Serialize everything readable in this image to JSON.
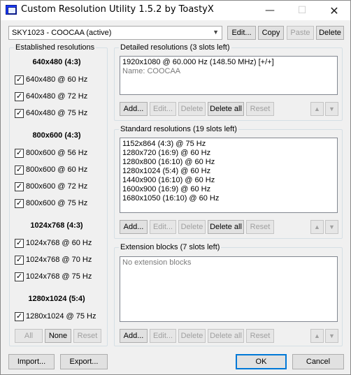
{
  "window": {
    "title": "Custom Resolution Utility 1.5.2 by ToastyX",
    "minimize_glyph": "—",
    "maximize_glyph": "☐",
    "close_glyph": "✕"
  },
  "toolbar": {
    "monitor_select": "SKY1023 - COOCAA (active)",
    "edit_label": "Edit...",
    "copy_label": "Copy",
    "paste_label": "Paste",
    "delete_label": "Delete"
  },
  "established": {
    "title": "Established resolutions",
    "check_glyph": "✓",
    "groups": [
      {
        "header": "640x480 (4:3)",
        "items": [
          "640x480 @ 60 Hz",
          "640x480 @ 72 Hz",
          "640x480 @ 75 Hz"
        ]
      },
      {
        "header": "800x600 (4:3)",
        "items": [
          "800x600 @ 56 Hz",
          "800x600 @ 60 Hz",
          "800x600 @ 72 Hz",
          "800x600 @ 75 Hz"
        ]
      },
      {
        "header": "1024x768 (4:3)",
        "items": [
          "1024x768 @ 60 Hz",
          "1024x768 @ 70 Hz",
          "1024x768 @ 75 Hz"
        ]
      },
      {
        "header": "1280x1024 (5:4)",
        "items": [
          "1280x1024 @ 75 Hz"
        ]
      }
    ],
    "all_label": "All",
    "none_label": "None",
    "reset_label": "Reset"
  },
  "detailed": {
    "title": "Detailed resolutions (3 slots left)",
    "entry": "1920x1080 @ 60.000 Hz (148.50 MHz) [+/+]",
    "name": "Name: COOCAA",
    "add_label": "Add...",
    "edit_label": "Edit...",
    "delete_label": "Delete",
    "delete_all_label": "Delete all",
    "reset_label": "Reset"
  },
  "standard": {
    "title": "Standard resolutions (19 slots left)",
    "items": [
      "1152x864 (4:3) @ 75 Hz",
      "1280x720 (16:9) @ 60 Hz",
      "1280x800 (16:10) @ 60 Hz",
      "1280x1024 (5:4) @ 60 Hz",
      "1440x900 (16:10) @ 60 Hz",
      "1600x900 (16:9) @ 60 Hz",
      "1680x1050 (16:10) @ 60 Hz"
    ],
    "add_label": "Add...",
    "edit_label": "Edit...",
    "delete_label": "Delete",
    "delete_all_label": "Delete all",
    "reset_label": "Reset"
  },
  "extension": {
    "title": "Extension blocks (7 slots left)",
    "empty_text": "No extension blocks",
    "add_label": "Add...",
    "edit_label": "Edit...",
    "delete_label": "Delete",
    "delete_all_label": "Delete all",
    "reset_label": "Reset"
  },
  "arrows": {
    "up": "▲",
    "down": "▼"
  },
  "footer": {
    "import_label": "Import...",
    "export_label": "Export...",
    "ok_label": "OK",
    "cancel_label": "Cancel"
  },
  "colors": {
    "accent": "#0078d7",
    "window_bg": "#f0f0f0",
    "disabled_text": "#a0a0a0"
  }
}
